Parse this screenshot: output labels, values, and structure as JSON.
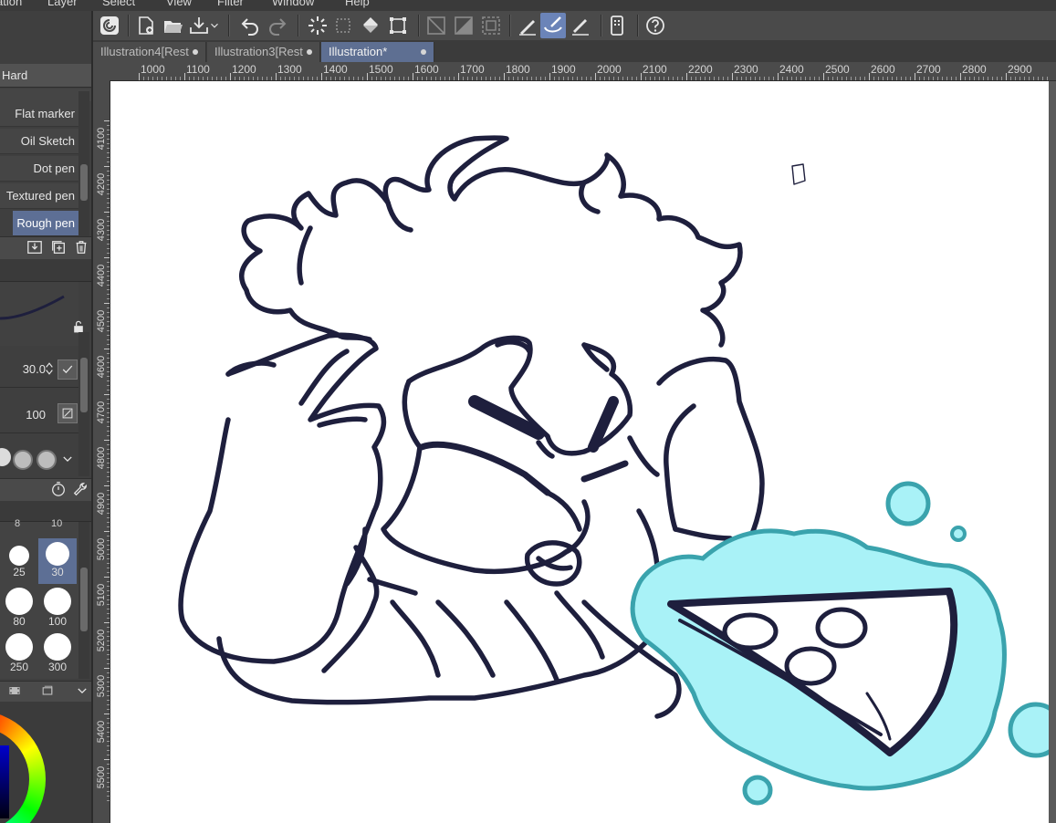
{
  "menu": {
    "items_partial": [
      "ation",
      "Layer",
      "Select",
      "View",
      "Filter",
      "Window",
      "Help"
    ]
  },
  "toolbar": {
    "icons": [
      "app-icon",
      "new-file-icon",
      "open-file-icon",
      "save-icon",
      "undo-icon",
      "redo-icon",
      "clear-icon",
      "deselect-icon",
      "fill-icon",
      "transform-icon",
      "hide-outside-icon",
      "invert-icon",
      "selection-border-icon",
      "pen-tool-icon",
      "brush-tool-icon",
      "eraser-tool-icon",
      "smartphone-icon",
      "help-icon"
    ]
  },
  "tabs": [
    {
      "label": "Illustration4[Rest",
      "active": false
    },
    {
      "label": "Illustration3[Rest",
      "active": false
    },
    {
      "label": "Illustration*",
      "active": true
    }
  ],
  "ruler": {
    "h_labels": [
      "1000",
      "1100",
      "1200",
      "1300",
      "1400",
      "1500",
      "1600",
      "1700",
      "1800",
      "1900",
      "2000",
      "2100",
      "2200",
      "2300",
      "2400",
      "2500",
      "2600",
      "2700",
      "2800",
      "2900"
    ],
    "v_labels": [
      "4100",
      "4200",
      "4300",
      "4400",
      "4500",
      "4600",
      "4700",
      "4800",
      "4900",
      "5000",
      "5100",
      "5200",
      "5300",
      "5400",
      "5500"
    ]
  },
  "sub_tool": {
    "header": "Hard",
    "items": [
      {
        "label": "Flat marker",
        "selected": false
      },
      {
        "label": "Oil Sketch",
        "selected": false
      },
      {
        "label": "Dot pen",
        "selected": false
      },
      {
        "label": "Textured pen",
        "selected": false
      },
      {
        "label": "Rough pen",
        "selected": true
      }
    ]
  },
  "tool_property": {
    "brush_size": "30.0",
    "opacity": "100"
  },
  "brush_sizes": {
    "partial_top": [
      "8",
      "10"
    ],
    "cells": [
      {
        "label": "25",
        "selected": false
      },
      {
        "label": "30",
        "selected": true
      },
      {
        "label": "80",
        "selected": false
      },
      {
        "label": "100",
        "selected": false
      },
      {
        "label": "250",
        "selected": false
      },
      {
        "label": "300",
        "selected": false
      }
    ]
  },
  "colors": {
    "line": "#1e1f3d",
    "glow_fill": "#a9f2f7",
    "glow_edge": "#3aa3ad",
    "tab_active": "#5e6f92",
    "tool_active": "#6b84b8"
  }
}
